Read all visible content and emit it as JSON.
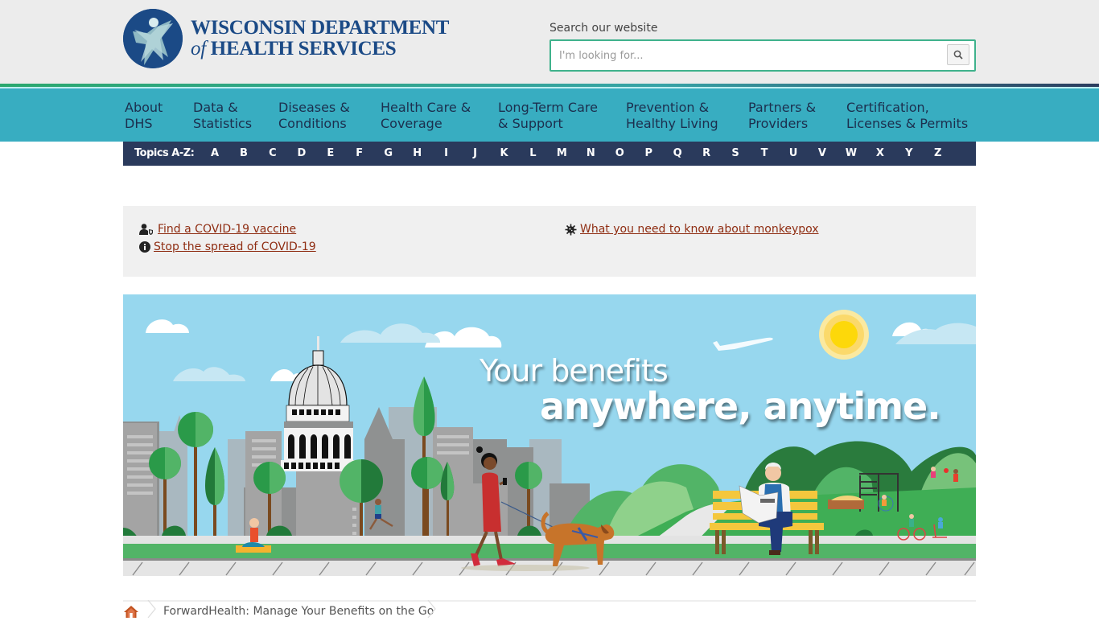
{
  "header": {
    "logo": {
      "line1": "WISCONSIN DEPARTMENT",
      "line2_of": "of",
      "line2_rest": " HEALTH SERVICES",
      "icon": "person-figure-logo-icon",
      "brand_color": "#1b4a86"
    },
    "search": {
      "label": "Search our website",
      "placeholder": "I'm looking for...",
      "value": "",
      "button_icon": "search-icon",
      "border_color": "#3fb28c"
    }
  },
  "main_nav": {
    "background": "#38adc1",
    "items": [
      {
        "line1": "About",
        "line2": "DHS"
      },
      {
        "line1": "Data &",
        "line2": "Statistics"
      },
      {
        "line1": "Diseases &",
        "line2": "Conditions"
      },
      {
        "line1": "Health Care &",
        "line2": "Coverage"
      },
      {
        "line1": "Long-Term Care",
        "line2": "& Support"
      },
      {
        "line1": "Prevention &",
        "line2": "Healthy Living"
      },
      {
        "line1": "Partners &",
        "line2": "Providers"
      },
      {
        "line1": "Certification,",
        "line2": "Licenses & Permits"
      }
    ]
  },
  "topics_az": {
    "label": "Topics A-Z:",
    "letters": [
      "A",
      "B",
      "C",
      "D",
      "E",
      "F",
      "G",
      "H",
      "I",
      "J",
      "K",
      "L",
      "M",
      "N",
      "O",
      "P",
      "Q",
      "R",
      "S",
      "T",
      "U",
      "V",
      "W",
      "X",
      "Y",
      "Z"
    ],
    "background": "#2a3a5c"
  },
  "alerts": {
    "left": [
      {
        "icon": "user-shield-icon",
        "text": "Find a COVID-19 vaccine"
      },
      {
        "icon": "info-circle-icon",
        "text": "Stop the spread of COVID-19"
      }
    ],
    "right": [
      {
        "icon": "virus-icon",
        "text": "What you need to know about monkeypox"
      }
    ],
    "link_color": "#8f2d12"
  },
  "hero": {
    "title_line1": "Your benefits",
    "title_line2": "anywhere, anytime."
  },
  "breadcrumb": {
    "home_icon": "home-icon",
    "current": "ForwardHealth: Manage Your Benefits on the Go"
  }
}
